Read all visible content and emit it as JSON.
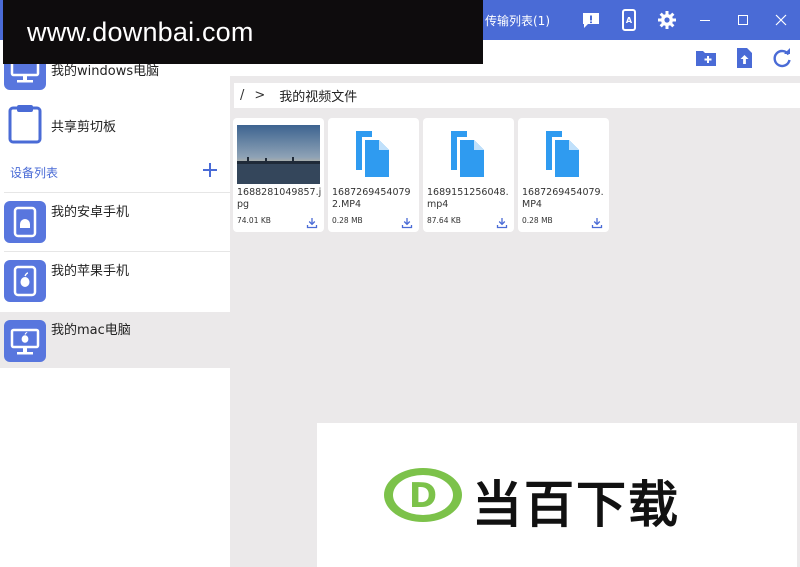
{
  "watermark": {
    "text": "www.downbai.com"
  },
  "titlebar": {
    "transfer_label": "传输列表(1)",
    "icons": [
      "feedback-icon",
      "phone-screen-icon",
      "settings-icon"
    ],
    "window_controls": [
      "minimize-icon",
      "maximize-icon",
      "close-icon"
    ]
  },
  "sidebar": {
    "items_top": [
      {
        "label": "我的windows电脑",
        "icon": "desktop-icon"
      },
      {
        "label": "共享剪切板",
        "icon": "clipboard-icon"
      }
    ],
    "section_title": "设备列表",
    "devices": [
      {
        "label": "我的安卓手机",
        "icon": "android-phone-icon"
      },
      {
        "label": "我的苹果手机",
        "icon": "apple-phone-icon"
      },
      {
        "label": "我的mac电脑",
        "icon": "mac-desktop-icon",
        "selected": true
      }
    ]
  },
  "toolbar": {
    "icons": [
      "new-folder-icon",
      "upload-icon",
      "refresh-icon"
    ]
  },
  "path": {
    "root": "/",
    "separator": ">",
    "current": "我的视频文件"
  },
  "files": [
    {
      "name": "1688281049857.jpg",
      "size": "74.01  KB",
      "type": "image"
    },
    {
      "name": "16872694540792.MP4",
      "size": "0.28  MB",
      "type": "video"
    },
    {
      "name": "1689151256048.mp4",
      "size": "87.64  KB",
      "type": "video"
    },
    {
      "name": "1687269454079.MP4",
      "size": "0.28  MB",
      "type": "video"
    }
  ],
  "ad": {
    "logo_letter": "D",
    "text": "当百下载"
  },
  "colors": {
    "brand": "#4a6bd6",
    "file_icon": "#2f9bf0",
    "device_icon": "#5876de",
    "background": "#ebe9ea"
  }
}
